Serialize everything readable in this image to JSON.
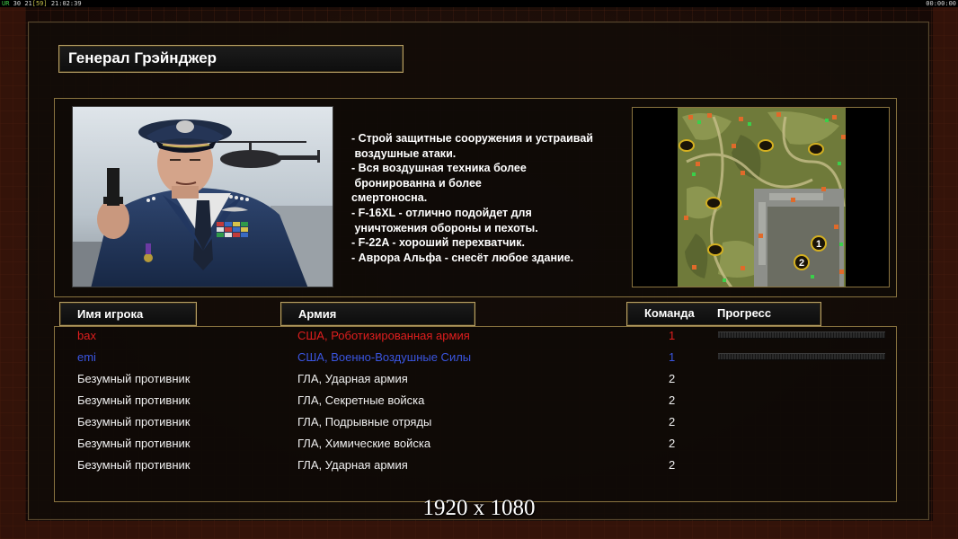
{
  "status_bar": {
    "left_tag": "UR",
    "left_a": "30",
    "left_b": "21",
    "left_bracket": "[59]",
    "left_time": "21:02:39",
    "right_time": "00:00:00"
  },
  "general": {
    "title": "Генерал Грэйнджер",
    "description_lines": [
      "- Строй защитные сооружения и устраивай",
      " воздушные атаки.",
      "- Вся воздушная техника более",
      " бронированна и более",
      "смертоносна.",
      "- F-16XL - отлично подойдет для",
      " уничтожения обороны и пехоты.",
      "- F-22A - хороший перехватчик.",
      "- Аврора Альфа - снесёт любое здание."
    ]
  },
  "minimap": {
    "start_markers": [
      "1",
      "2"
    ]
  },
  "table": {
    "headers": {
      "name": "Имя игрока",
      "army": "Армия",
      "team": "Команда",
      "progress": "Прогресс"
    },
    "players": [
      {
        "name": "bax",
        "army": "США, Роботизированная армия",
        "team": "1",
        "color": "#e01e1e",
        "progress": 0.0,
        "show_progress": true
      },
      {
        "name": "emi",
        "army": "США, Военно-Воздушные Силы",
        "team": "1",
        "color": "#3a55e0",
        "progress": 0.0,
        "show_progress": true
      },
      {
        "name": "Безумный противник",
        "army": "ГЛА, Ударная армия",
        "team": "2",
        "color": "#f0f0f0",
        "show_progress": false
      },
      {
        "name": "Безумный противник",
        "army": "ГЛА, Секретные войска",
        "team": "2",
        "color": "#f0f0f0",
        "show_progress": false
      },
      {
        "name": "Безумный противник",
        "army": "ГЛА, Подрывные отряды",
        "team": "2",
        "color": "#f0f0f0",
        "show_progress": false
      },
      {
        "name": "Безумный противник",
        "army": "ГЛА, Химические войска",
        "team": "2",
        "color": "#f0f0f0",
        "show_progress": false
      },
      {
        "name": "Безумный противник",
        "army": "ГЛА, Ударная армия",
        "team": "2",
        "color": "#f0f0f0",
        "show_progress": false
      }
    ]
  },
  "overlay": {
    "resolution_caption": "1920 x 1080"
  }
}
